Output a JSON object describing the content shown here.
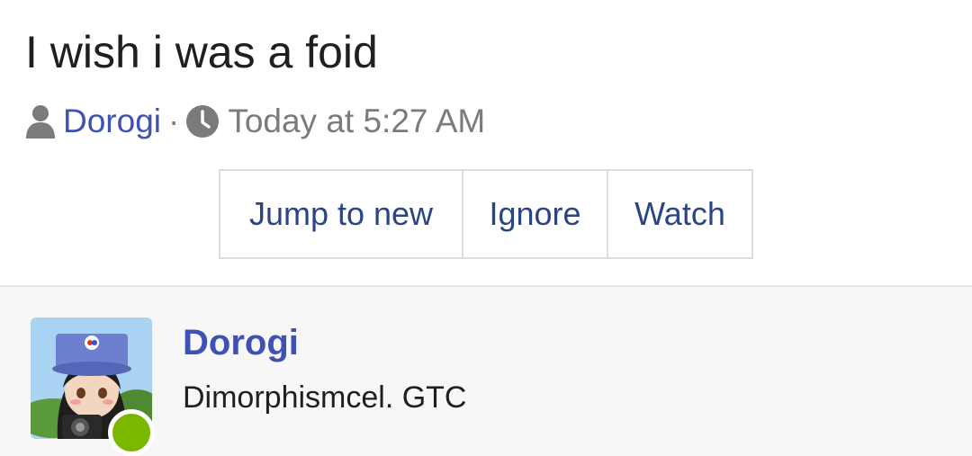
{
  "thread": {
    "title": "I wish i was a foid",
    "author": "Dorogi",
    "separator": "·",
    "timestamp": "Today at 5:27 AM"
  },
  "actions": {
    "jump_to_new": "Jump to new",
    "ignore": "Ignore",
    "watch": "Watch"
  },
  "post": {
    "username": "Dorogi",
    "user_title": "Dimorphismcel. GTC",
    "status_color": "#7ab800"
  },
  "colors": {
    "link": "#3f51b5",
    "button_text": "#2b4486"
  },
  "icons": [
    "user-icon",
    "clock-icon"
  ]
}
